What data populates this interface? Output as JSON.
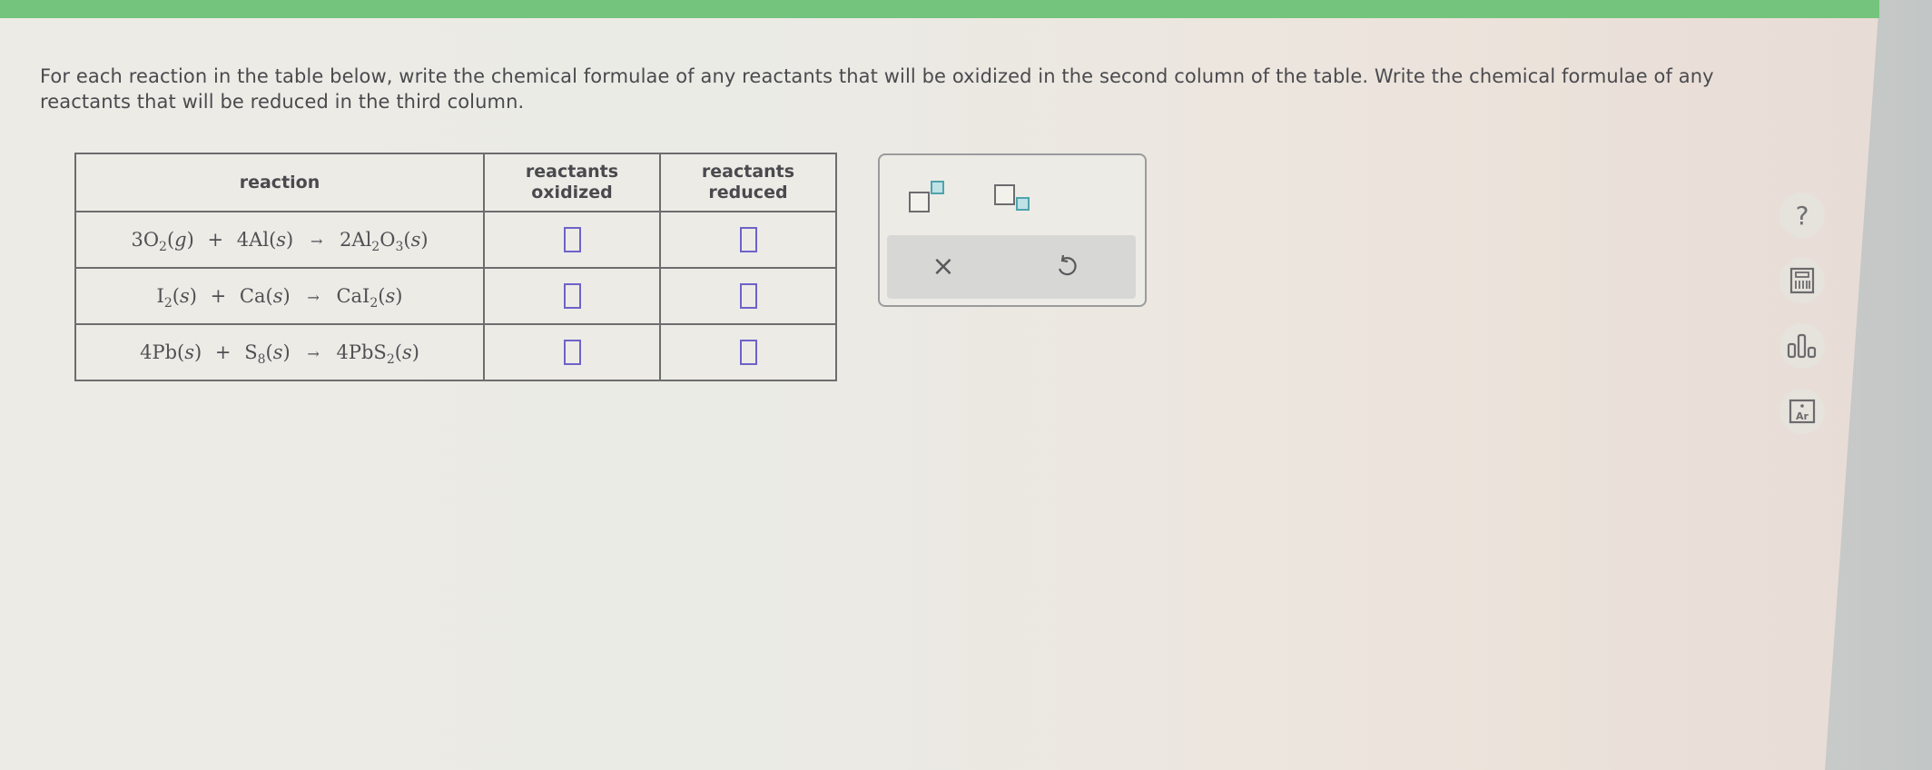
{
  "instructions": "For each reaction in the table below, write the chemical formulae of any reactants that will be oxidized in the second column of the table. Write the chemical formulae of any reactants that will be reduced in the third column.",
  "table": {
    "headers": {
      "reaction": "reaction",
      "oxidized_line1": "reactants",
      "oxidized_line2": "oxidized",
      "reduced_line1": "reactants",
      "reduced_line2": "reduced"
    },
    "rows": [
      {
        "reaction": {
          "r1_coef": "3",
          "r1": "O",
          "r1_sub": "2",
          "r1_state": "g",
          "r2_coef": "4",
          "r2": "Al",
          "r2_sub": "",
          "r2_state": "s",
          "p_coef": "2",
          "p_a": "Al",
          "p_a_sub": "2",
          "p_b": "O",
          "p_b_sub": "3",
          "p_state": "s"
        },
        "oxidized_value": "",
        "reduced_value": ""
      },
      {
        "reaction": {
          "r1_coef": "",
          "r1": "I",
          "r1_sub": "2",
          "r1_state": "s",
          "r2_coef": "",
          "r2": "Ca",
          "r2_sub": "",
          "r2_state": "s",
          "p_coef": "",
          "p_a": "CaI",
          "p_a_sub": "2",
          "p_b": "",
          "p_b_sub": "",
          "p_state": "s"
        },
        "oxidized_value": "",
        "reduced_value": ""
      },
      {
        "reaction": {
          "r1_coef": "4",
          "r1": "Pb",
          "r1_sub": "",
          "r1_state": "s",
          "r2_coef": "",
          "r2": "S",
          "r2_sub": "8",
          "r2_state": "s",
          "p_coef": "4",
          "p_a": "PbS",
          "p_a_sub": "2",
          "p_b": "",
          "p_b_sub": "",
          "p_state": "s"
        },
        "oxidized_value": "",
        "reduced_value": ""
      }
    ],
    "symbols": {
      "plus": "+",
      "arrow": "→",
      "open": "(",
      "close": ")"
    }
  },
  "toolpanel": {
    "superscript_icon": "superscript-icon",
    "subscript_icon": "subscript-icon",
    "clear_label": "×",
    "undo_icon": "undo-icon"
  },
  "side_tools": {
    "help_label": "?",
    "items": [
      "help-icon",
      "calculator-icon",
      "bar-chart-icon",
      "periodic-table-icon"
    ],
    "periodic_label": "Ar"
  },
  "colors": {
    "top_bar": "#74c47d",
    "answer_box_border": "#6e62c9",
    "tool_accent": "#4fa3ad"
  }
}
